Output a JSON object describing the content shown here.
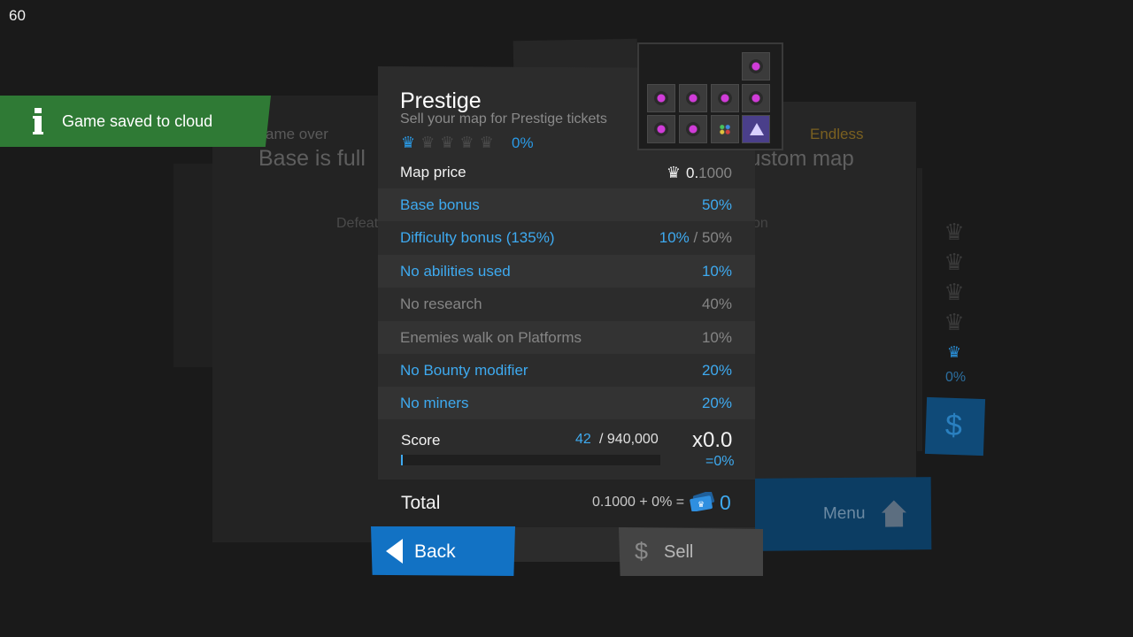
{
  "fps": "60",
  "toast": {
    "message": "Game saved to cloud",
    "icon": "info-icon"
  },
  "background": {
    "left_label": "Game over",
    "left_label_visible": "ame over",
    "left_title": "Base is full",
    "left_defeat": "Defeat",
    "right_mode": "Endless",
    "right_title": "Custom map",
    "right_title_visible": "ustom map",
    "right_small": "on",
    "right_pct": "0%",
    "menu_label": "Menu"
  },
  "prestige": {
    "title": "Prestige",
    "subtitle": "Sell your map for Prestige tickets",
    "crowns_total": 5,
    "crowns_lit": 1,
    "progress_pct": "0%",
    "map_price_label": "Map price",
    "map_price_int": "0.",
    "map_price_frac": "1000",
    "bonuses": [
      {
        "label": "Base bonus",
        "value": "50%",
        "active": true
      },
      {
        "label": "Difficulty bonus (135%)",
        "value": "10%",
        "max": " / 50%",
        "active": true
      },
      {
        "label": "No abilities used",
        "value": "10%",
        "active": true
      },
      {
        "label": "No research",
        "value": "40%",
        "active": false
      },
      {
        "label": "Enemies walk on Platforms",
        "value": "10%",
        "active": false
      },
      {
        "label": "No Bounty modifier",
        "value": "20%",
        "active": true
      },
      {
        "label": "No miners",
        "value": "20%",
        "active": true
      }
    ],
    "score": {
      "label": "Score",
      "value": "42",
      "max": "/ 940,000",
      "fill_fraction": 4.47e-05,
      "multiplier": "x0.0",
      "mult_pct": "=0%"
    },
    "total": {
      "label": "Total",
      "formula": "0.1000 + 0% =",
      "value": "0"
    },
    "back_label": "Back",
    "sell_label": "Sell"
  },
  "colors": {
    "accent": "#3eaaf0",
    "button_blue": "#1272c4",
    "toast_green": "#2f7a35"
  }
}
